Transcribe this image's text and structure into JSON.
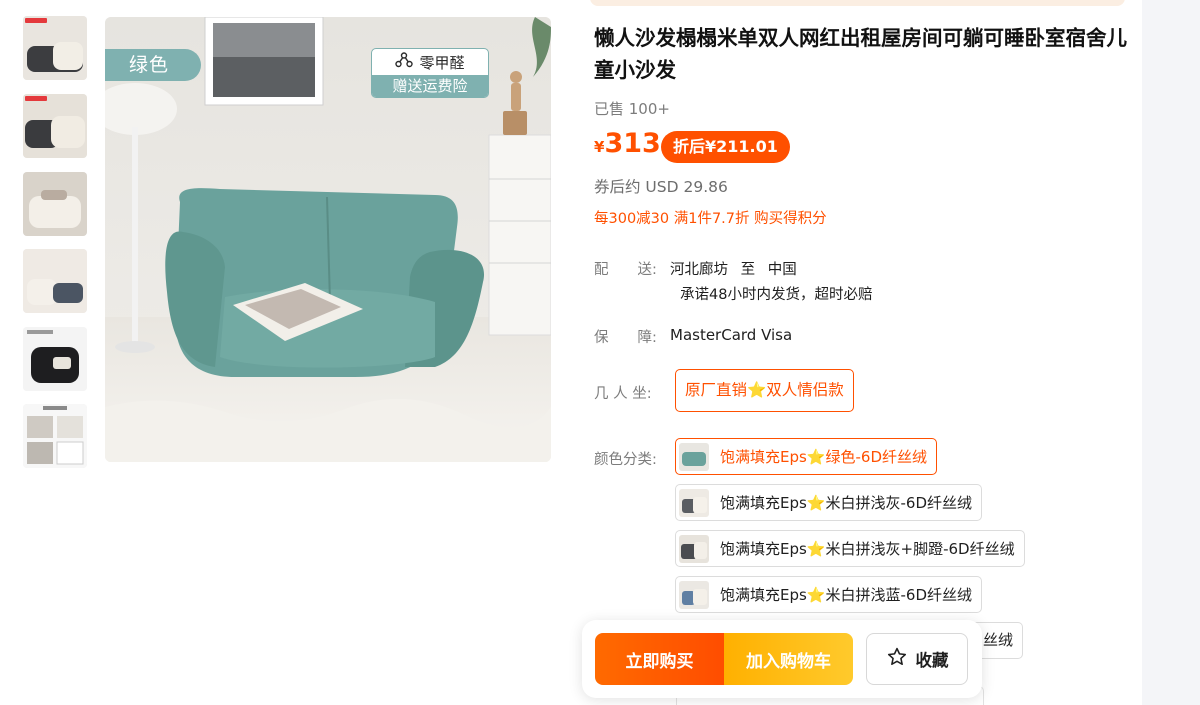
{
  "image": {
    "color_tag": "绿色",
    "promo_top": "零甲醛",
    "promo_bottom": "赠送运费险"
  },
  "product": {
    "title": "懒人沙发榻榻米单双人网红出租屋房间可躺可睡卧室宿舍儿童小沙发",
    "sold": "已售 100+",
    "currency": "¥",
    "price": "313",
    "discount_price": "折后¥211.01",
    "usd_price": "券后约 USD 29.86",
    "promotion": "每300减30 满1件7.7折 购买得积分"
  },
  "shipping": {
    "label": "配　　送:",
    "from": "河北廊坊",
    "to_word": "至",
    "to": "中国",
    "promise": "承诺48小时内发货，超时必赔"
  },
  "guarantee": {
    "label": "保　　障:",
    "value": "MasterCard Visa"
  },
  "seats": {
    "label": "几 人 坐:",
    "option": "原厂直销⭐双人情侣款"
  },
  "colors": {
    "label": "颜色分类:",
    "options": [
      {
        "prefix": "饱满填充Eps",
        "suffix": "绿色-6D纤丝绒",
        "selected": true
      },
      {
        "prefix": "饱满填充Eps",
        "suffix": "米白拼浅灰-6D纤丝绒",
        "selected": false
      },
      {
        "prefix": "饱满填充Eps",
        "suffix": "米白拼浅灰+脚蹬-6D纤丝绒",
        "selected": false
      },
      {
        "prefix": "饱满填充Eps",
        "suffix": "米白拼浅蓝-6D纤丝绒",
        "selected": false
      }
    ],
    "peek_suffix": "丝绒"
  },
  "actions": {
    "buy_now": "立即购买",
    "add_to_cart": "加入购物车",
    "favorite": "收藏"
  },
  "theme": {
    "accent": "#ff5000",
    "cart_yellow": "#ffb000",
    "tag_teal": "#7fb1b0"
  },
  "icons": [
    "molecule-icon",
    "star-outline-icon",
    "star-icon"
  ]
}
